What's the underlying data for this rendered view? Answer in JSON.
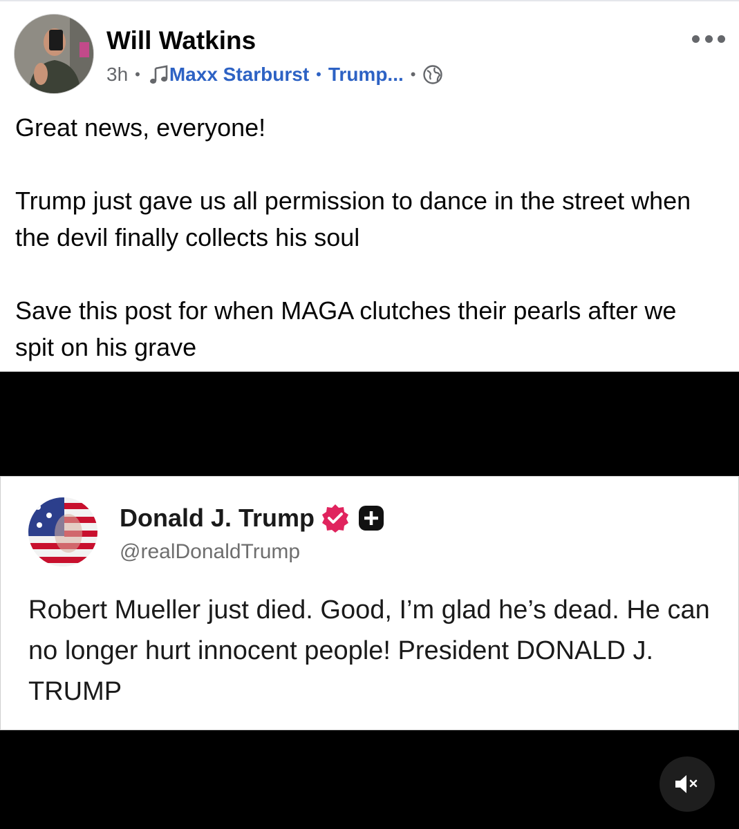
{
  "post": {
    "author": "Will Watkins",
    "time": "3h",
    "music_label": "Maxx Starburst",
    "tag_label": "Trump...",
    "visibility_icon": "globe-icon",
    "text": "Great news, everyone!\n\nTrump just gave us all permission to dance in the street when the devil finally collects his soul\n\nSave this post for when MAGA clutches their pearls after we spit on his grave"
  },
  "embedded_post": {
    "name": "Donald J. Trump",
    "handle": "@realDonaldTrump",
    "text": "Robert Mueller just died. Good, I’m glad he’s dead. He can no longer hurt innocent people! President DONALD J. TRUMP",
    "verified_color": "#e0245e"
  },
  "colors": {
    "link": "#2d62c4",
    "meta_gray": "#65676b",
    "media_bg": "#000000"
  },
  "icons": {
    "more": "more-horizontal-icon",
    "music": "music-note-icon",
    "mute": "speaker-muted-icon"
  }
}
